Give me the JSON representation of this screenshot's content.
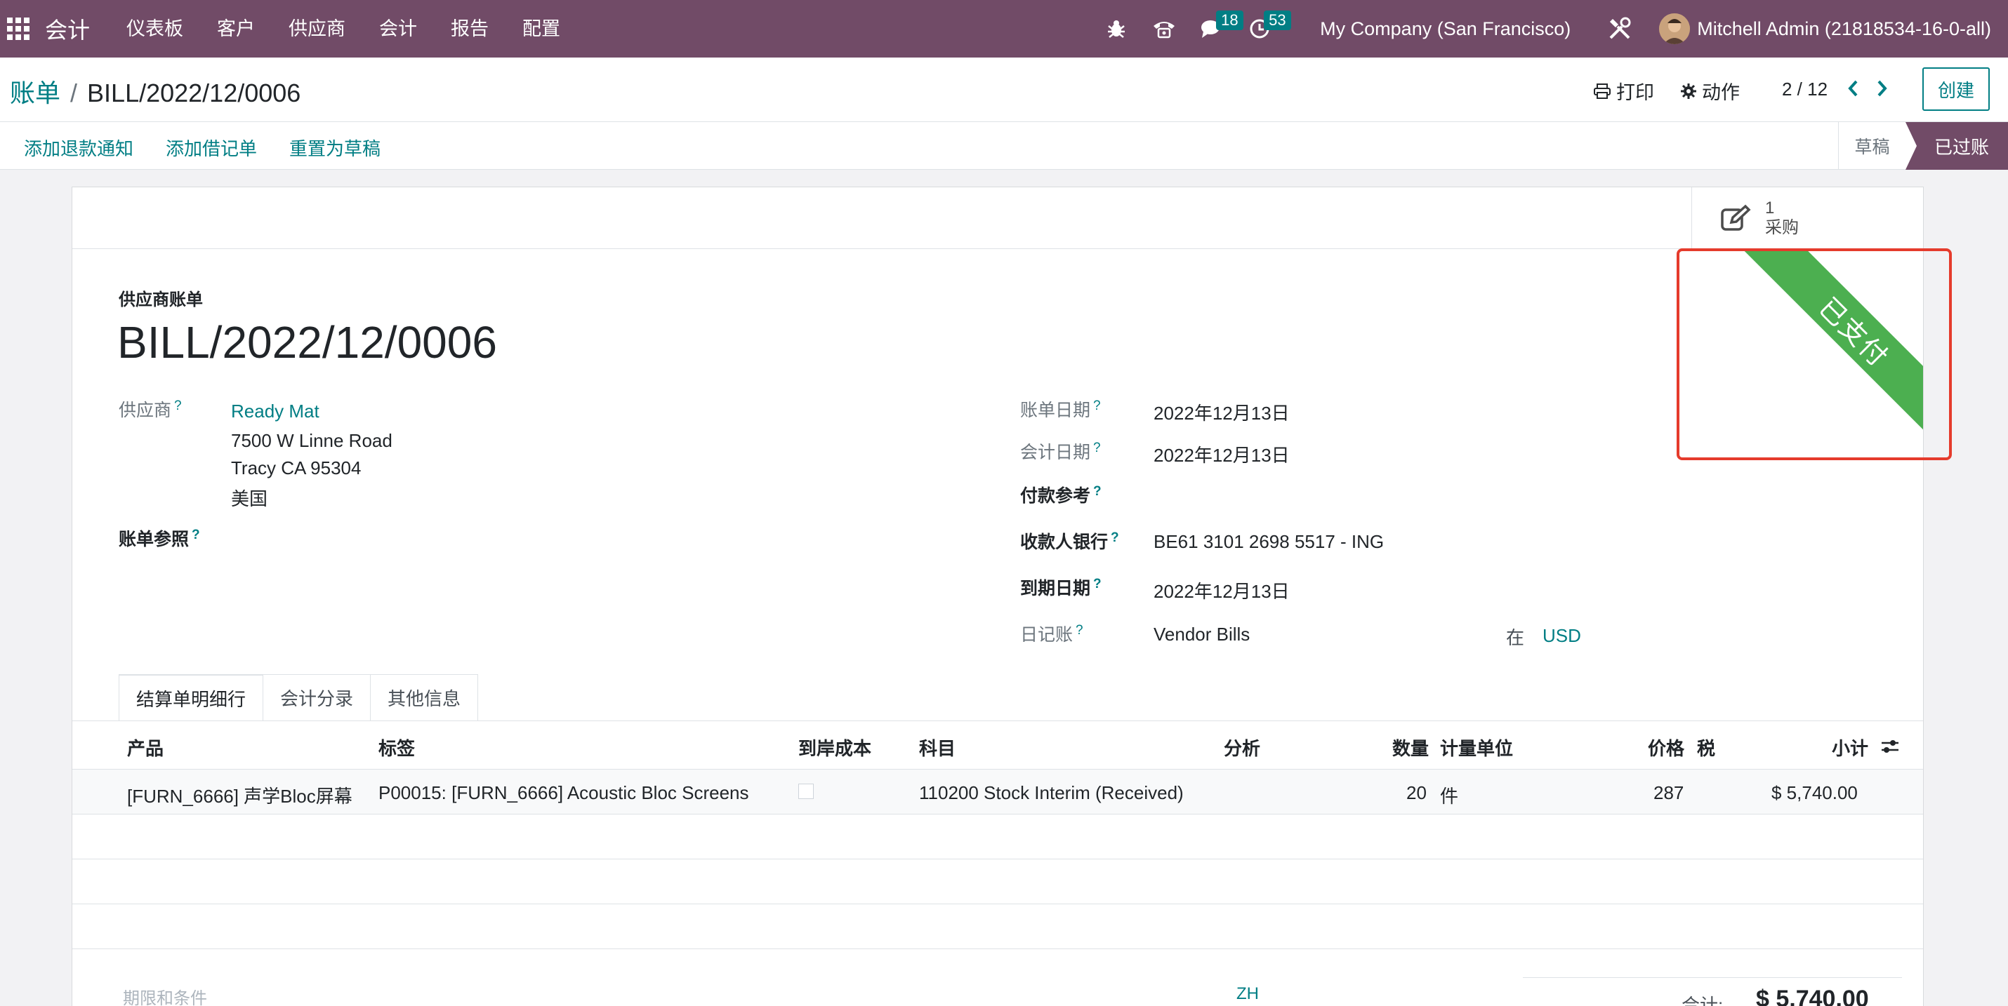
{
  "navbar": {
    "app_name": "会计",
    "menu": [
      "仪表板",
      "客户",
      "供应商",
      "会计",
      "报告",
      "配置"
    ],
    "messages_count": "18",
    "activities_count": "53",
    "company": "My Company (San Francisco)",
    "user": "Mitchell Admin (21818534-16-0-all)",
    "bg_color": "#714b67"
  },
  "control_panel": {
    "breadcrumb_parent": "账单",
    "breadcrumb_sep": "/",
    "breadcrumb_current": "BILL/2022/12/0006",
    "print_label": "打印",
    "action_label": "动作",
    "pager": "2 / 12",
    "create_label": "创建"
  },
  "statusbar": {
    "buttons": [
      "添加退款通知",
      "添加借记单",
      "重置为草稿"
    ],
    "stages": [
      "草稿",
      "已过账"
    ]
  },
  "smart_button": {
    "count": "1",
    "label": "采购"
  },
  "ribbon": {
    "label": "已支付",
    "color": "#4caf50"
  },
  "form": {
    "doc_type": "供应商账单",
    "name": "BILL/2022/12/0006",
    "vendor_label": "供应商",
    "vendor_name": "Ready Mat",
    "vendor_address": [
      "7500 W Linne Road",
      "Tracy CA 95304",
      "美国"
    ],
    "bill_ref_label": "账单参照",
    "bill_date_label": "账单日期",
    "bill_date": "2022年12月13日",
    "accounting_date_label": "会计日期",
    "accounting_date": "2022年12月13日",
    "payment_ref_label": "付款参考",
    "bank_label": "收款人银行",
    "bank": "BE61 3101 2698 5517 - ING",
    "due_date_label": "到期日期",
    "due_date": "2022年12月13日",
    "journal_label": "日记账",
    "journal": "Vendor Bills",
    "in_label": "在",
    "currency": "USD",
    "help_mark": "?"
  },
  "tabs": [
    "结算单明细行",
    "会计分录",
    "其他信息"
  ],
  "table": {
    "headers": [
      "产品",
      "标签",
      "到岸成本",
      "科目",
      "分析",
      "数量",
      "计量单位",
      "价格",
      "税",
      "小计"
    ],
    "rows": [
      {
        "product": "[FURN_6666] 声学Bloc屏幕",
        "label": "P00015: [FURN_6666] Acoustic Bloc Screens",
        "account": "110200 Stock Interim (Received)",
        "qty": "20",
        "uom": "件",
        "price": "287",
        "subtotal": "$ 5,740.00"
      }
    ]
  },
  "footer": {
    "terms_placeholder": "期限和条件",
    "lang": "ZH",
    "total_label": "合计:",
    "total": "$ 5,740.00"
  }
}
